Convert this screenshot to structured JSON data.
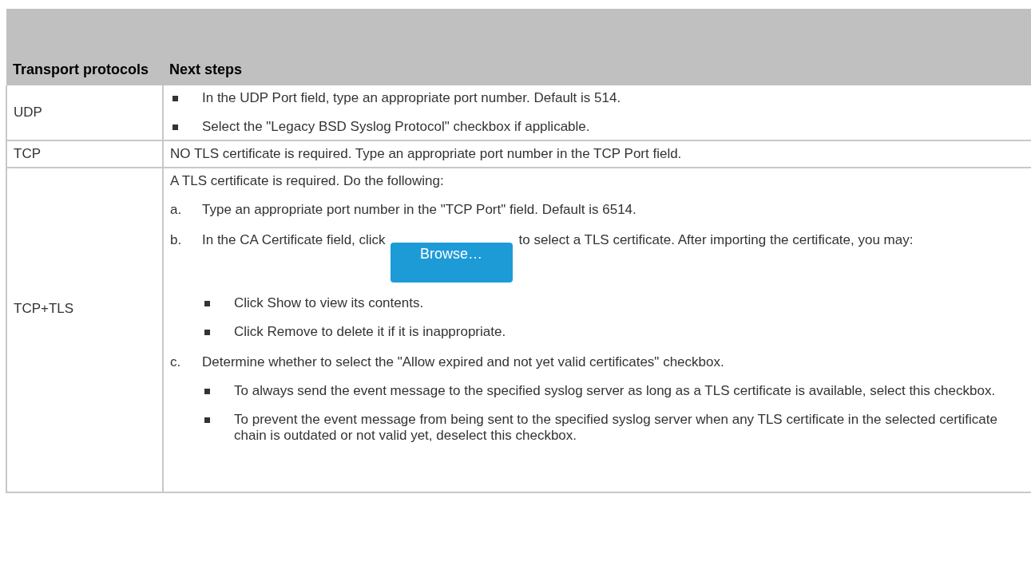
{
  "table": {
    "columns": [
      "Transport protocols",
      "Next steps"
    ],
    "rows": [
      {
        "protocol": "UDP",
        "steps": [
          {
            "kind": "bullets",
            "items": [
              "In the UDP Port field, type an appropriate port number. Default is 514.",
              "Select the \"Legacy BSD Syslog Protocol\" checkbox if applicable."
            ]
          }
        ]
      },
      {
        "protocol": "TCP",
        "steps": [
          {
            "kind": "paragraph",
            "text": "NO TLS certificate is required. Type an appropriate port number in the TCP Port field."
          }
        ]
      },
      {
        "protocol": "TCP+TLS",
        "steps": [
          {
            "kind": "paragraph",
            "text": "A TLS certificate is required. Do the following:"
          },
          {
            "kind": "lettered",
            "items": [
              {
                "marker": "a.",
                "text": "Type an appropriate port number in the \"TCP Port\" field. Default is 6514."
              },
              {
                "marker": "b.",
                "text": "In the CA Certificate field, click",
                "button": "Browse…",
                "text_after": "to select a TLS certificate. After importing the certificate, you may:",
                "bullets": [
                  "Click Show to view its contents.",
                  "Click Remove to delete it if it is inappropriate."
                ]
              },
              {
                "marker": "c.",
                "text": "Determine whether to select the \"Allow expired and not yet valid certificates\" checkbox.",
                "bullets": [
                  "To always send the event message to the specified syslog server as long as a TLS certificate is available, select this checkbox.",
                  "To prevent the event message from being sent to the specified syslog server when any TLS certificate in the selected certificate chain is outdated or not valid yet, deselect this checkbox."
                ]
              }
            ]
          }
        ]
      }
    ]
  }
}
